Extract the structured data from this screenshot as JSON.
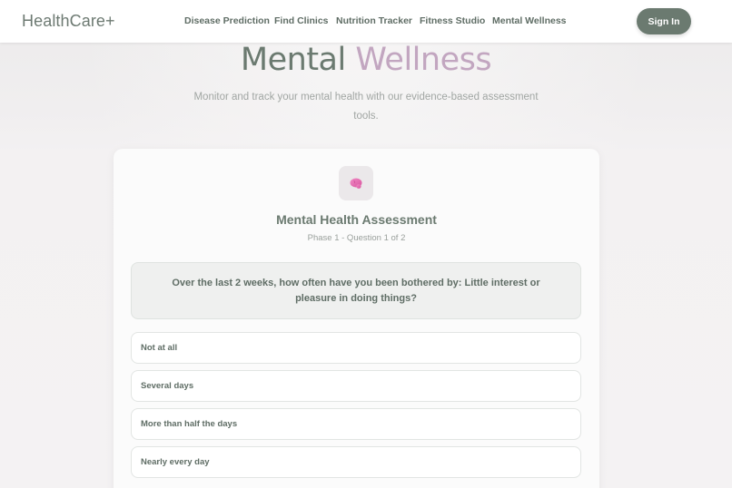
{
  "navbar": {
    "brand": "HealthCare+",
    "links": [
      "Disease Prediction",
      "Find Clinics",
      "Nutrition Tracker",
      "Fitness Studio",
      "Mental Wellness"
    ],
    "signin_label": "Sign In"
  },
  "hero": {
    "title_part1": "Mental",
    "title_part2": "Wellness",
    "subtitle": "Monitor and track your mental health with our evidence-based assessment tools."
  },
  "assessment": {
    "icon": "brain-icon",
    "title": "Mental Health Assessment",
    "progress": "Phase 1 - Question 1 of 2",
    "question": "Over the last 2 weeks, how often have you been bothered by: Little interest or pleasure in doing things?",
    "options": [
      "Not at all",
      "Several days",
      "More than half the days",
      "Nearly every day"
    ]
  },
  "colors": {
    "primary": "#6b7a70",
    "accent": "#c2a6c0",
    "icon_pink": "#e573b4"
  }
}
